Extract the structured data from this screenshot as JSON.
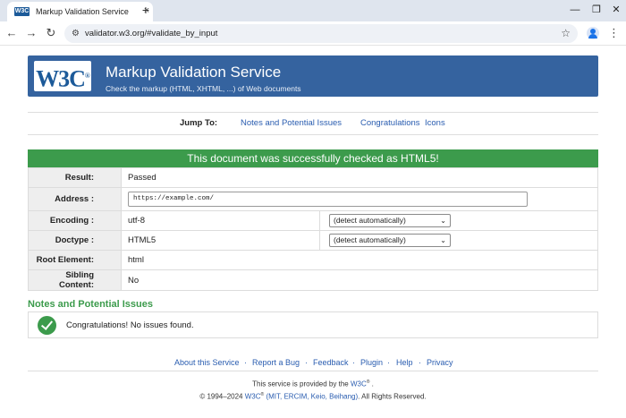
{
  "browser": {
    "tab_favicon": "W3C",
    "tab_title": "Markup Validation Service",
    "url": "validator.w3.org/#validate_by_input",
    "icons": {
      "close": "×",
      "new_tab": "+",
      "back": "←",
      "forward": "→",
      "reload": "↻",
      "site_info": "⚙",
      "star": "☆",
      "menu": "⋮",
      "minimize": "—",
      "restore": "❐",
      "close_window": "✕"
    }
  },
  "banner": {
    "logo": "W3C",
    "title": "Markup Validation Service",
    "subtitle": "Check the markup (HTML, XHTML, ...) of Web documents"
  },
  "jump": {
    "label": "Jump To:",
    "links": [
      "Notes and Potential Issues",
      "Congratulations",
      "Icons"
    ],
    "separator": "·"
  },
  "result_banner": "This document was successfully checked as HTML5!",
  "results": {
    "result_label": "Result:",
    "result_value": "Passed",
    "address_label": "Address :",
    "address_value": "https://example.com/",
    "encoding_label": "Encoding :",
    "encoding_value": "utf-8",
    "encoding_select": "(detect automatically)",
    "doctype_label": "Doctype :",
    "doctype_value": "HTML5",
    "doctype_select": "(detect automatically)",
    "root_label": "Root Element:",
    "root_value": "html",
    "sibling_label": "Sibling Content:",
    "sibling_value": "No"
  },
  "notes": {
    "title": "Notes and Potential Issues",
    "message": "Congratulations! No issues found."
  },
  "footer": {
    "links": [
      "About this Service",
      "Report a Bug",
      "Feedback",
      "Plugin",
      "Help",
      "Privacy"
    ],
    "separator": "·",
    "provided_prefix": "This service is provided by the",
    "provided_link": "W3C",
    "provided_suffix": ".",
    "copyright_prefix": "© 1994–2024",
    "copyright_w3c": "W3C",
    "copyright_orgs": "(MIT, ERCIM, Keio, Beihang)",
    "copyright_suffix": ". All Rights Reserved."
  },
  "colors": {
    "banner_bg": "#35639f",
    "success_green": "#3c9b4c",
    "link_blue": "#2a5db0",
    "label_bg": "#eeeeee"
  }
}
